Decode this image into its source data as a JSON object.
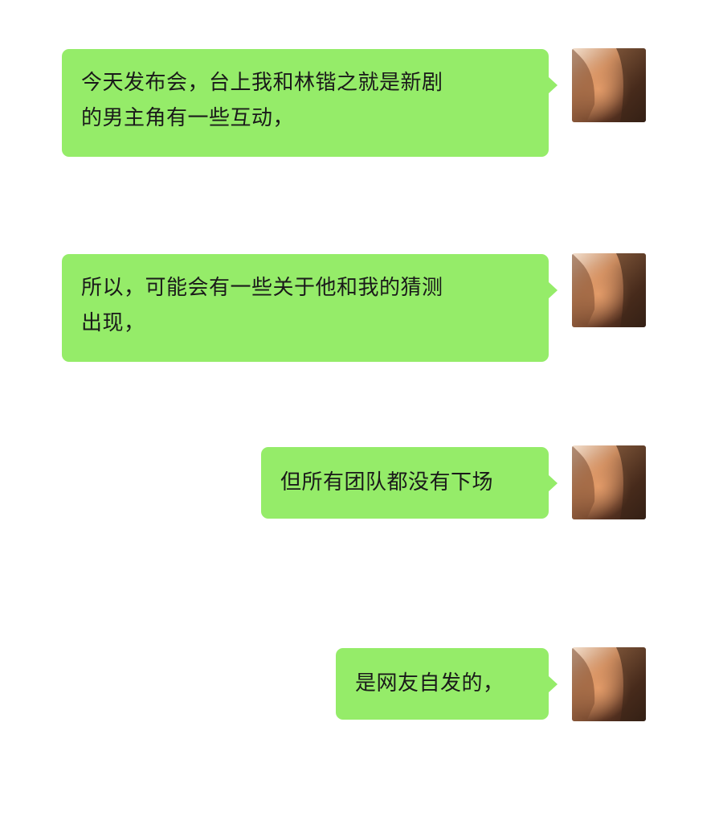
{
  "messages": [
    {
      "text": "今天发布会，台上我和林锴之就是新剧\n的男主角有一些互动，",
      "sender": "self"
    },
    {
      "text": "所以，可能会有一些关于他和我的猜测\n出现，",
      "sender": "self"
    },
    {
      "text": "但所有团队都没有下场",
      "sender": "self"
    },
    {
      "text": "是网友自发的，",
      "sender": "self"
    }
  ],
  "colors": {
    "bubble": "#95ec69",
    "background": "#ffffff",
    "text": "#1a1a1a"
  },
  "icons": {
    "avatar": "user-avatar-photo"
  }
}
